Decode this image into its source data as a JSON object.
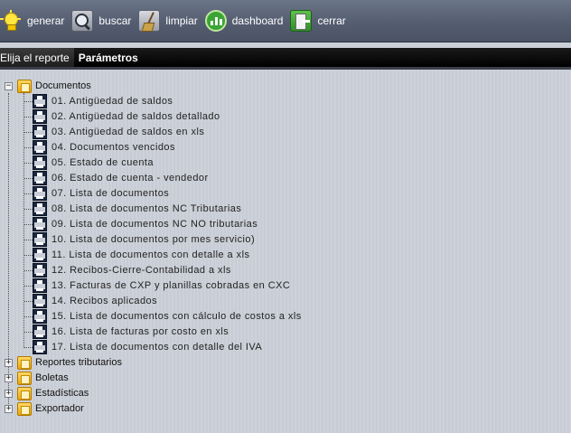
{
  "toolbar": {
    "buttons": [
      {
        "label": "generar",
        "icon": "lightbulb-icon"
      },
      {
        "label": "buscar",
        "icon": "magnifier-icon"
      },
      {
        "label": "limpiar",
        "icon": "broom-icon"
      },
      {
        "label": "dashboard",
        "icon": "dashboard-chart-icon"
      },
      {
        "label": "cerrar",
        "icon": "exit-door-icon"
      }
    ]
  },
  "tabs": [
    {
      "label": "Elija el reporte",
      "active": true
    },
    {
      "label": "Parámetros",
      "active": false
    }
  ],
  "tree": {
    "documentos": {
      "label": "Documentos",
      "expanded": true,
      "items": [
        "01. Antigüedad de saldos",
        "02. Antigüedad de saldos detallado",
        "03. Antigüedad de saldos en xls",
        "04. Documentos vencidos",
        "05. Estado de cuenta",
        "06. Estado de cuenta - vendedor",
        "07. Lista de documentos",
        "08. Lista de documentos NC Tributarias",
        "09. Lista de documentos NC NO tributarias",
        "10. Lista de documentos por mes servicio)",
        "11. Lista de documentos con detalle a xls",
        "12. Recibos-Cierre-Contabilidad a xls",
        "13. Facturas de CXP y planillas cobradas en CXC",
        "14. Recibos aplicados",
        "15. Lista de documentos con cálculo de costos a xls",
        "16. Lista de facturas por costo en xls",
        "17. Lista de documentos con detalle del IVA"
      ]
    },
    "collapsed_folders": [
      "Reportes tributarios",
      "Boletas",
      "Estadísticas",
      "Exportador"
    ]
  },
  "colors": {
    "toolbar_bg": "#59616f",
    "tab_bar_bg": "#000000",
    "tree_bg": "#ccd0d8",
    "folder_icon": "#f3b31c",
    "printer_icon": "#1a2740"
  }
}
